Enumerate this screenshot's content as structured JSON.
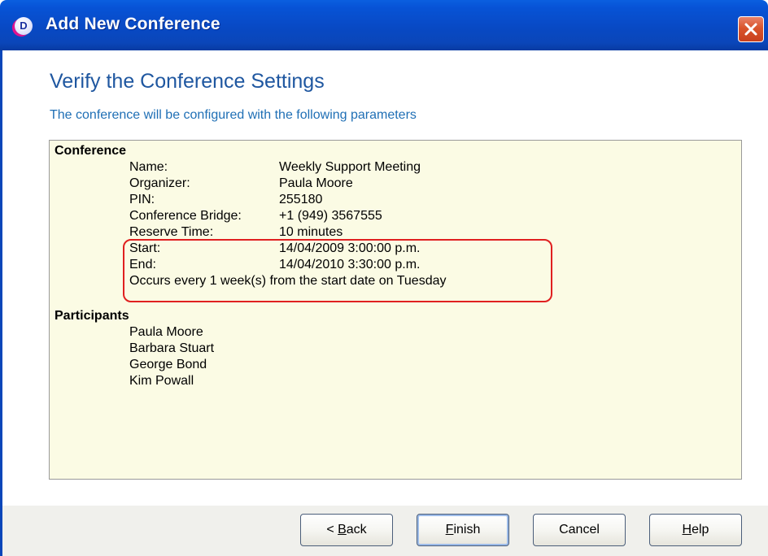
{
  "window": {
    "title": "Add New Conference",
    "app_icon_letter": "D",
    "accent_color": "#0849c4"
  },
  "header": {
    "heading": "Verify the Conference Settings",
    "subheading": "The conference will be configured with the following parameters"
  },
  "conference": {
    "section_title": "Conference",
    "fields": [
      {
        "label": "Name:",
        "value": "Weekly Support Meeting"
      },
      {
        "label": "Organizer:",
        "value": "Paula Moore"
      },
      {
        "label": "PIN:",
        "value": "255180"
      },
      {
        "label": "Conference Bridge:",
        "value": "+1 (949) 3567555"
      },
      {
        "label": "Reserve Time:",
        "value": "10 minutes"
      },
      {
        "label": "Start:",
        "value": "14/04/2009 3:00:00 p.m."
      },
      {
        "label": "End:",
        "value": "14/04/2010 3:30:00 p.m."
      }
    ],
    "recurrence": "Occurs every 1 week(s) from the start date on Tuesday"
  },
  "participants": {
    "section_title": "Participants",
    "names": [
      "Paula Moore",
      "Barbara Stuart",
      "George Bond",
      "Kim Powall"
    ]
  },
  "buttons": {
    "back": {
      "before": "< ",
      "mnemonic": "B",
      "after": "ack"
    },
    "finish": {
      "before": "",
      "mnemonic": "F",
      "after": "inish"
    },
    "cancel": {
      "label": "Cancel"
    },
    "help": {
      "before": "",
      "mnemonic": "H",
      "after": "elp"
    }
  }
}
